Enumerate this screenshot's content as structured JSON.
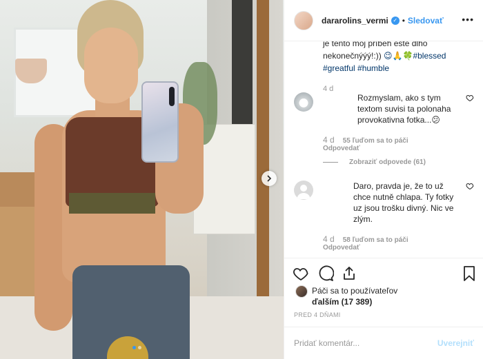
{
  "post": {
    "username": "dararolins_vermi",
    "follow_label": "Sledovať",
    "more_label": "•••",
    "caption": {
      "line1": "je tento môj príbeh ešte dlho",
      "line2_text": "nekonečnýýý!:)) ",
      "line2_tags": "😉🙏🍀#blessed",
      "line3_tags": "#greatful #humble",
      "time": "4 d"
    },
    "comments": [
      {
        "text": "Rozmyslam, ako s tym textom suvisi ta polonaha provokativna fotka...😕",
        "time": "4 d",
        "likes": "55 ľuďom sa to páči",
        "reply": "Odpovedať",
        "view_replies": "Zobraziť odpovede (61)"
      },
      {
        "text": "Daro, pravda je, že to už chce nutně chlapa. Ty fotky uz jsou trošku divný. Nic ve zlým.",
        "time": "4 d",
        "likes": "58 ľuďom sa to páči",
        "reply": "Odpovedať"
      }
    ],
    "likes_line1": "Páči sa to používateľov",
    "likes_line2": "ďalším (17 389)",
    "posted_ago": "PRED 4 DŇAMI",
    "comment_placeholder": "Pridať komentár...",
    "post_label": "Uverejniť",
    "carousel": {
      "count": 2,
      "active_index": 0
    }
  },
  "colors": {
    "accent": "#3897f0",
    "hashtag": "#003569",
    "muted": "#999999",
    "text": "#262626"
  },
  "icons": [
    "verified-badge-icon",
    "more-options-icon",
    "heart-icon",
    "comment-icon",
    "share-icon",
    "bookmark-icon",
    "next-arrow-icon"
  ]
}
